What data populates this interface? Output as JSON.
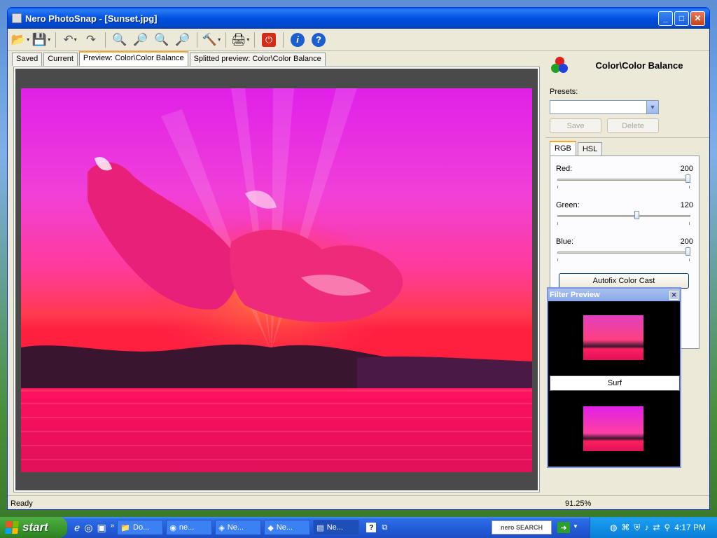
{
  "window": {
    "title": "Nero PhotoSnap - [Sunset.jpg]",
    "min": "_",
    "max": "□",
    "close": "✕"
  },
  "toolbar": {
    "icons": [
      "open-folder-icon",
      "save-icon",
      "undo-icon",
      "redo-icon",
      "zoom-fit-icon",
      "zoom-in-icon",
      "zoom-actual-icon",
      "zoom-out-icon",
      "tools-icon",
      "print-icon",
      "exit-icon",
      "info-icon",
      "help-icon"
    ]
  },
  "tabs": [
    "Saved",
    "Current",
    "Preview: Color\\Color Balance",
    "Splitted preview: Color\\Color Balance"
  ],
  "panel": {
    "title": "Color\\Color Balance",
    "presets_label": "Presets:",
    "preset_value": "",
    "save_label": "Save",
    "delete_label": "Delete",
    "tab_rgb": "RGB",
    "tab_hsl": "HSL",
    "sliders": [
      {
        "name": "Red:",
        "value": "200",
        "fraction": 1.0
      },
      {
        "name": "Green:",
        "value": "120",
        "fraction": 0.6
      },
      {
        "name": "Blue:",
        "value": "200",
        "fraction": 1.0
      }
    ],
    "autofix_label": "Autofix Color Cast"
  },
  "filter_preview": {
    "title": "Filter Preview",
    "button": "Surf"
  },
  "status": {
    "text": "Ready",
    "zoom": "91.25%"
  },
  "taskbar": {
    "start": "start",
    "buttons": [
      "Do...",
      "ne...",
      "Ne...",
      "Ne...",
      "Ne..."
    ],
    "nero_search": "nero SEARCH",
    "time": "4:17 PM"
  },
  "colors": {
    "accent": "#f5a623",
    "titlebar": "#0050e0"
  }
}
